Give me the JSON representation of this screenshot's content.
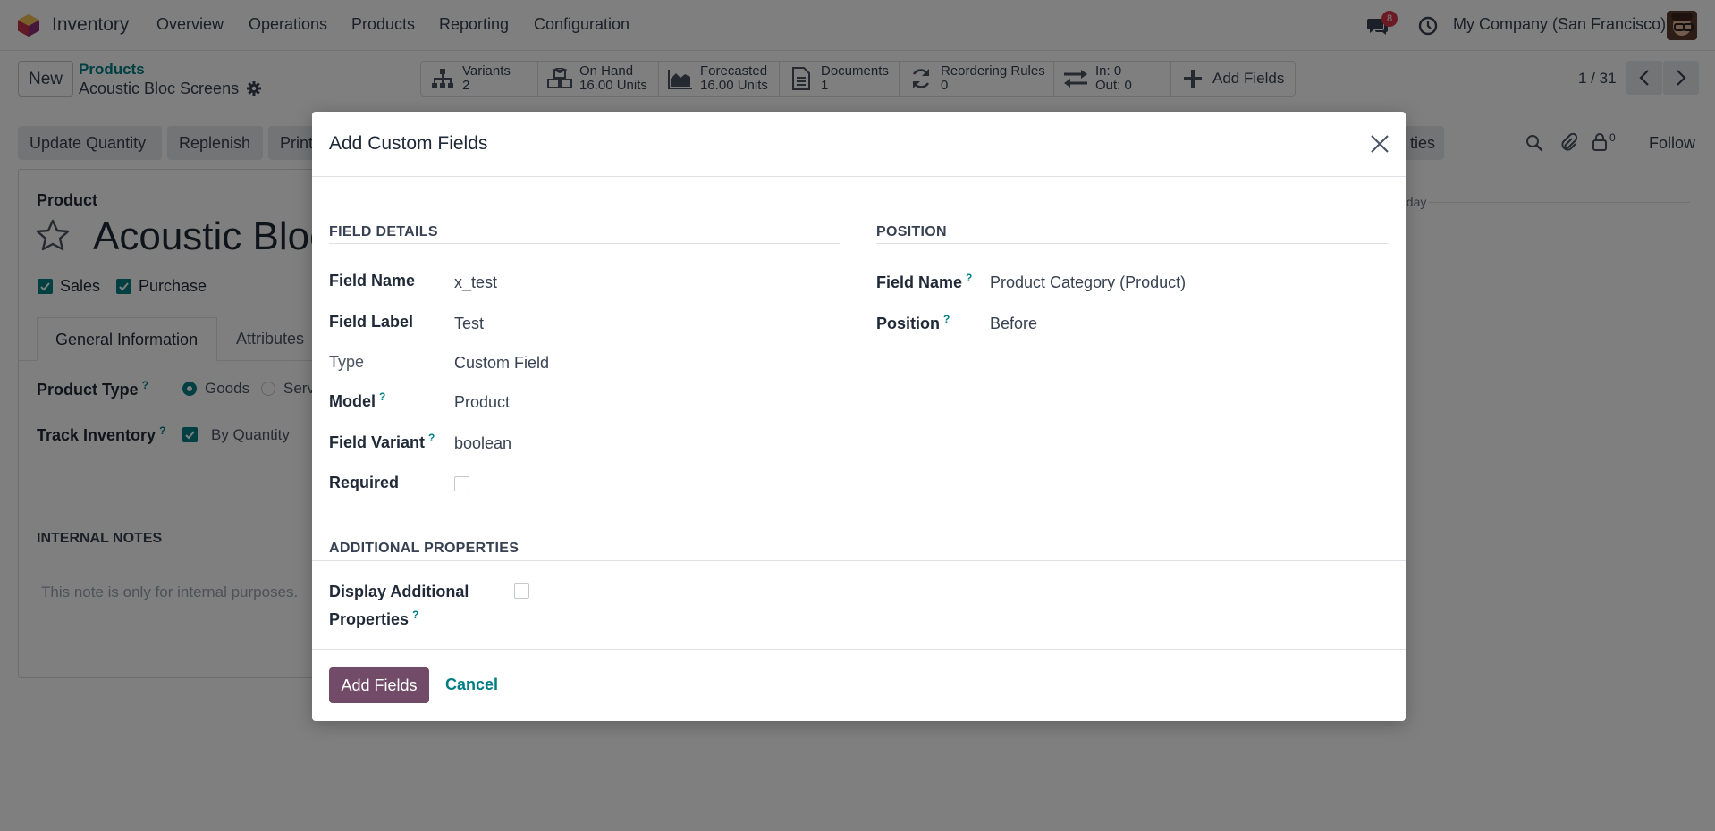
{
  "navbar": {
    "app_name": "Inventory",
    "menu": [
      "Overview",
      "Operations",
      "Products",
      "Reporting",
      "Configuration"
    ],
    "messages_count": "8",
    "company": "My Company (San Francisco)"
  },
  "control_panel": {
    "new_label": "New",
    "breadcrumb_parent": "Products",
    "breadcrumb_current": "Acoustic Bloc Screens",
    "stats": [
      {
        "label": "Variants",
        "value": "2",
        "icon": "sitemap-icon"
      },
      {
        "label": "On Hand",
        "value": "16.00 Units",
        "icon": "cubes-icon"
      },
      {
        "label": "Forecasted",
        "value": "16.00 Units",
        "icon": "area-chart-icon"
      },
      {
        "label": "Documents",
        "value": "1",
        "icon": "document-icon"
      },
      {
        "label": "Reordering Rules",
        "value": "0",
        "icon": "refresh-icon"
      },
      {
        "label": "In: 0",
        "value": "Out: 0",
        "icon": "exchange-icon"
      },
      {
        "label": "Add Fields",
        "value": "",
        "icon": "plus-icon"
      }
    ],
    "pager": "1 / 31"
  },
  "actions": {
    "update_quantity": "Update Quantity",
    "replenish": "Replenish",
    "print": "Print",
    "right_fragment": "ties",
    "follow": "Follow",
    "followers_count": "0"
  },
  "form": {
    "product_label": "Product",
    "product_name": "Acoustic Bloc",
    "sales_label": "Sales",
    "purchase_label": "Purchase",
    "tab_general": "General Information",
    "tab_attributes": "Attributes",
    "product_type_label": "Product Type",
    "product_type_goods": "Goods",
    "product_type_service": "Serv",
    "track_inventory_label": "Track Inventory",
    "track_inventory_value": "By Quantity",
    "internal_notes_title": "INTERNAL NOTES",
    "internal_notes_placeholder": "This note is only for internal purposes.",
    "chatter_today": "oday"
  },
  "modal": {
    "title": "Add Custom Fields",
    "field_details": {
      "title": "FIELD DETAILS",
      "field_name_label": "Field Name",
      "field_name_value": "x_test",
      "field_label_label": "Field Label",
      "field_label_value": "Test",
      "type_label": "Type",
      "type_value": "Custom Field",
      "model_label": "Model",
      "model_value": "Product",
      "field_variant_label": "Field Variant",
      "field_variant_value": "boolean",
      "required_label": "Required",
      "required_checked": false
    },
    "position": {
      "title": "POSITION",
      "field_name_label": "Field Name",
      "field_name_value": "Product Category (Product)",
      "position_label": "Position",
      "position_value": "Before"
    },
    "additional": {
      "title": "ADDITIONAL PROPERTIES",
      "display_label_line1": "Display Additional",
      "display_label_line2": "Properties",
      "display_checked": false
    },
    "help_mark": "?",
    "add_fields_button": "Add Fields",
    "cancel_button": "Cancel"
  },
  "colors": {
    "brand": "#714b67",
    "link": "#017e84",
    "badge": "#d9374b"
  }
}
